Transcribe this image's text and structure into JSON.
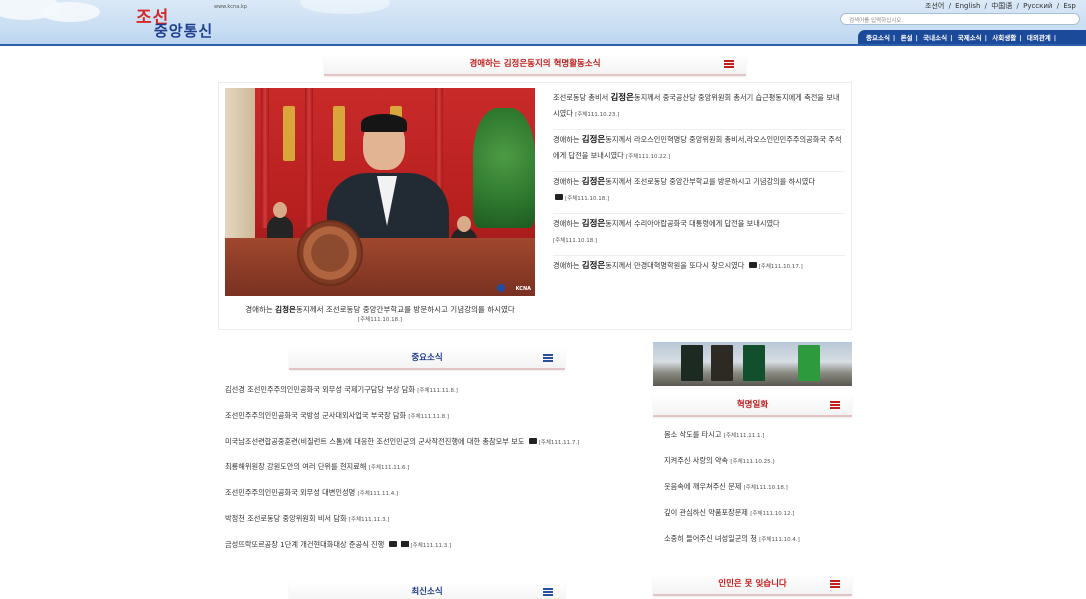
{
  "header": {
    "logo_top": "조선",
    "logo_bottom": "중앙통신",
    "logo_url": "www.kcna.kp",
    "languages": [
      "조선어",
      "/",
      "English",
      "/",
      "中国语",
      "/",
      "Русский",
      "/",
      "Esp"
    ],
    "search_placeholder": "검색어를 입력하십시오.",
    "nav": [
      "중요소식",
      "|",
      "론설",
      "|",
      "국내소식",
      "|",
      "국제소식",
      "|",
      "사회생활",
      "|",
      "대외관계",
      "|"
    ]
  },
  "feature": {
    "title": "경애하는 김정은동지의 혁명활동소식",
    "caption_pre": "경애하는 ",
    "caption_name": "김정은",
    "caption_post": "동지께서 조선로동당 중앙간부학교를 방문하시고 기념강의를 하시였다",
    "caption_date": "[주체111.10.18.]",
    "photo_mark": "KCNA",
    "items": [
      {
        "pre": "조선로동당 총비서 ",
        "name": "김정은",
        "post": "동지께서 중국공산당 중앙위원회 총서기 습근평동지에게 축전을 보내시였다",
        "date": "[주체111.10.23.]"
      },
      {
        "pre": "경애하는 ",
        "name": "김정은",
        "post": "동지께서 라오스인민혁명당 중앙위원회 총비서,라오스인민민주주의공화국 주석에게 답전을 보내시였다",
        "date": "[주체111.10.22.]"
      },
      {
        "pre": "경애하는 ",
        "name": "김정은",
        "post": "동지께서 조선로동당 중앙간부학교를 방문하시고 기념강의를 하시였다",
        "date": "[주체111.10.18.]"
      },
      {
        "pre": "경애하는 ",
        "name": "김정은",
        "post": "동지께서 수리아아랍공화국 대통령에게 답전을 보내시였다",
        "date": "[주체111.10.18.]"
      },
      {
        "pre": "경애하는 ",
        "name": "김정은",
        "post": "동지께서 만경대혁명학원을 또다시 찾으시였다",
        "date": "[주체111.10.17.]"
      }
    ]
  },
  "important": {
    "title": "중요소식",
    "items": [
      {
        "text": "김선경 조선민주주의인민공화국 외무성 국제기구담당 부상 담화",
        "date": "[주체111.11.8.]"
      },
      {
        "text": "조선민주주의인민공화국 국방성 군사대외사업국 부국장 담화",
        "date": "[주체111.11.8.]"
      },
      {
        "text": "미국남조선련합공중훈련(비질런트 스톰)에 대응한 조선인민군의 군사작전진행에 대한 총참모부 보도",
        "date": "[주체111.11.7.]"
      },
      {
        "text": "최룡해위원장 강원도안의 여러 단위를 현지료해",
        "date": "[주체111.11.6.]"
      },
      {
        "text": "조선민주주의인민공화국 외무성 대변인성명",
        "date": "[주체111.11.4.]"
      },
      {
        "text": "박정천 조선로동당 중앙위원회 비서 담화",
        "date": "[주체111.11.3.]"
      },
      {
        "text": "금성뜨락또르공장 1단계 개건현대화대상 준공식 진행",
        "date": "[주체111.11.3.]"
      }
    ]
  },
  "revolution": {
    "title": "혁명일화",
    "items": [
      {
        "text": "몸소 삭도를 타시고",
        "date": "[주체111.11.1.]"
      },
      {
        "text": "지켜주신 사랑의 약속",
        "date": "[주체111.10.25.]"
      },
      {
        "text": "웃음속에 깨우쳐주신 문제",
        "date": "[주체111.10.18.]"
      },
      {
        "text": "깊이 관심하신 약품포장문제",
        "date": "[주체111.10.12.]"
      },
      {
        "text": "소중히 들어주신 녀성일군의 청",
        "date": "[주체111.10.4.]"
      }
    ]
  },
  "latest": {
    "title": "최신소식"
  },
  "people": {
    "title": "인민은 못 잊습니다"
  },
  "colors": {
    "brand_red": "#c21d1d",
    "brand_blue": "#1d3d8c",
    "nav_bg": "#1c4a9a"
  }
}
